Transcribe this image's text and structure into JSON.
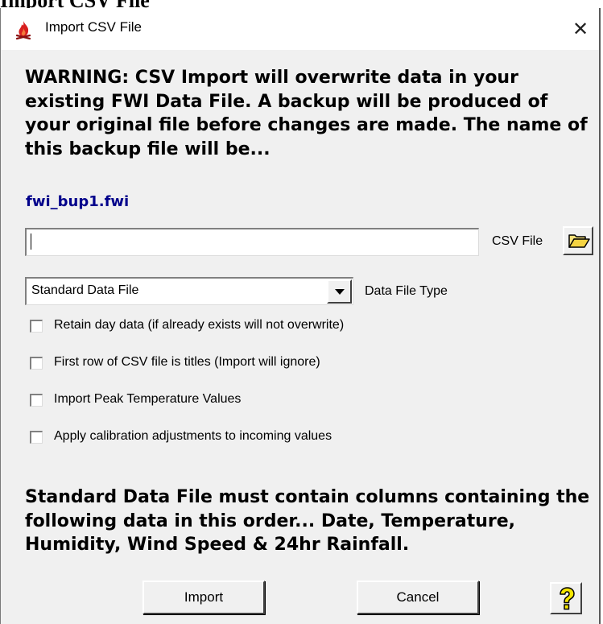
{
  "background": {
    "caption": "Import CSV File"
  },
  "window": {
    "title": "Import CSV File",
    "close_glyph": "✕",
    "app_icon": "fire-icon"
  },
  "warning_text": "WARNING: CSV Import will overwrite data in your existing FWI Data File. A backup will be produced of your original file before changes are made. The name of this backup file will be...",
  "backup_filename": "fwi_bup1.fwi",
  "csv_file": {
    "value": "",
    "label": "CSV File",
    "browse_icon": "folder-open-icon"
  },
  "data_file_type": {
    "selected": "Standard Data File",
    "label": "Data File Type"
  },
  "options": [
    {
      "label": "Retain day data (if already exists will not overwrite)",
      "checked": false
    },
    {
      "label": "First row of CSV file is titles (Import will ignore)",
      "checked": false
    },
    {
      "label": "Import Peak Temperature Values",
      "checked": false
    },
    {
      "label": "Apply calibration adjustments to incoming values",
      "checked": false
    }
  ],
  "info_text": "Standard Data File must contain columns containing the following data in this order... Date, Temperature, Humidity, Wind Speed & 24hr Rainfall.",
  "buttons": {
    "import_label": "Import",
    "cancel_label": "Cancel",
    "help_icon": "help-question-icon"
  },
  "colors": {
    "dialog_bg": "#f0f0f0",
    "filename_color": "#00008b",
    "icon_red": "#d81e1e",
    "help_yellow": "#f5e600"
  }
}
